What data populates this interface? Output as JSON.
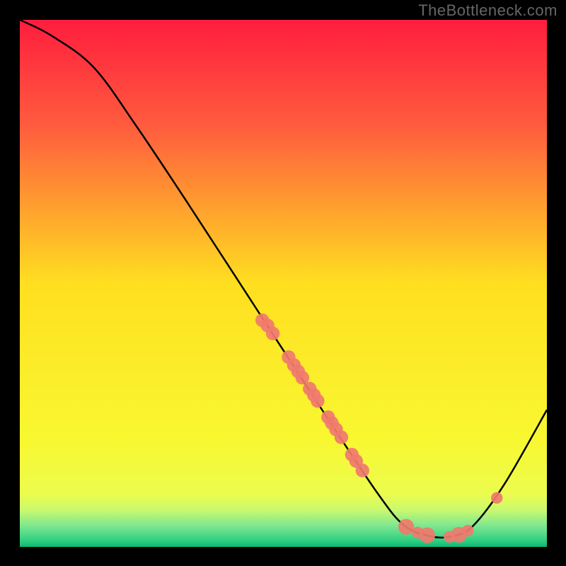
{
  "watermark": "TheBottleneck.com",
  "chart_data": {
    "type": "line",
    "title": "",
    "xlabel": "",
    "ylabel": "",
    "xlim": [
      0,
      100
    ],
    "ylim": [
      0,
      100
    ],
    "curve": [
      {
        "x": 0,
        "y": 100
      },
      {
        "x": 6,
        "y": 97
      },
      {
        "x": 14,
        "y": 91
      },
      {
        "x": 22,
        "y": 80
      },
      {
        "x": 32,
        "y": 65
      },
      {
        "x": 45,
        "y": 45
      },
      {
        "x": 58,
        "y": 25
      },
      {
        "x": 68,
        "y": 10
      },
      {
        "x": 73,
        "y": 4
      },
      {
        "x": 78,
        "y": 2
      },
      {
        "x": 82,
        "y": 2
      },
      {
        "x": 86,
        "y": 4
      },
      {
        "x": 92,
        "y": 12
      },
      {
        "x": 100,
        "y": 26
      }
    ],
    "markers": [
      {
        "x": 46,
        "y": 43,
        "r": 1.3
      },
      {
        "x": 47,
        "y": 42,
        "r": 1.3
      },
      {
        "x": 48,
        "y": 40.5,
        "r": 1.3
      },
      {
        "x": 51,
        "y": 36,
        "r": 1.3
      },
      {
        "x": 52,
        "y": 34.5,
        "r": 1.3
      },
      {
        "x": 52.8,
        "y": 33.3,
        "r": 1.3
      },
      {
        "x": 53.6,
        "y": 32.1,
        "r": 1.3
      },
      {
        "x": 55,
        "y": 30,
        "r": 1.3
      },
      {
        "x": 55.8,
        "y": 28.8,
        "r": 1.3
      },
      {
        "x": 56.5,
        "y": 27.7,
        "r": 1.3
      },
      {
        "x": 58.5,
        "y": 24.6,
        "r": 1.3
      },
      {
        "x": 59.2,
        "y": 23.5,
        "r": 1.3
      },
      {
        "x": 60,
        "y": 22.3,
        "r": 1.3
      },
      {
        "x": 61,
        "y": 20.8,
        "r": 1.3
      },
      {
        "x": 63,
        "y": 17.5,
        "r": 1.3
      },
      {
        "x": 63.8,
        "y": 16.3,
        "r": 1.3
      },
      {
        "x": 65,
        "y": 14.5,
        "r": 1.3
      },
      {
        "x": 73.3,
        "y": 3.8,
        "r": 1.5
      },
      {
        "x": 75.5,
        "y": 2.7,
        "r": 1.1
      },
      {
        "x": 77.3,
        "y": 2.2,
        "r": 1.5
      },
      {
        "x": 81.5,
        "y": 1.9,
        "r": 1.1
      },
      {
        "x": 83.3,
        "y": 2.3,
        "r": 1.5
      },
      {
        "x": 85,
        "y": 3.1,
        "r": 1.1
      },
      {
        "x": 90.5,
        "y": 9.3,
        "r": 1.1
      }
    ],
    "marker_color": "#f07a6e",
    "curve_color": "#000000",
    "green_band": {
      "y_min": 0,
      "y_max": 6
    },
    "gradient_stops": [
      {
        "y": 100,
        "color": "#ff1d3e"
      },
      {
        "y": 80,
        "color": "#ff5b3e"
      },
      {
        "y": 50,
        "color": "#ffdf20"
      },
      {
        "y": 20,
        "color": "#f8f831"
      },
      {
        "y": 10,
        "color": "#ecfc4e"
      },
      {
        "y": 7,
        "color": "#c9f96e"
      },
      {
        "y": 4,
        "color": "#7ee78f"
      },
      {
        "y": 1,
        "color": "#29cd80"
      },
      {
        "y": 0,
        "color": "#0fb573"
      }
    ]
  }
}
